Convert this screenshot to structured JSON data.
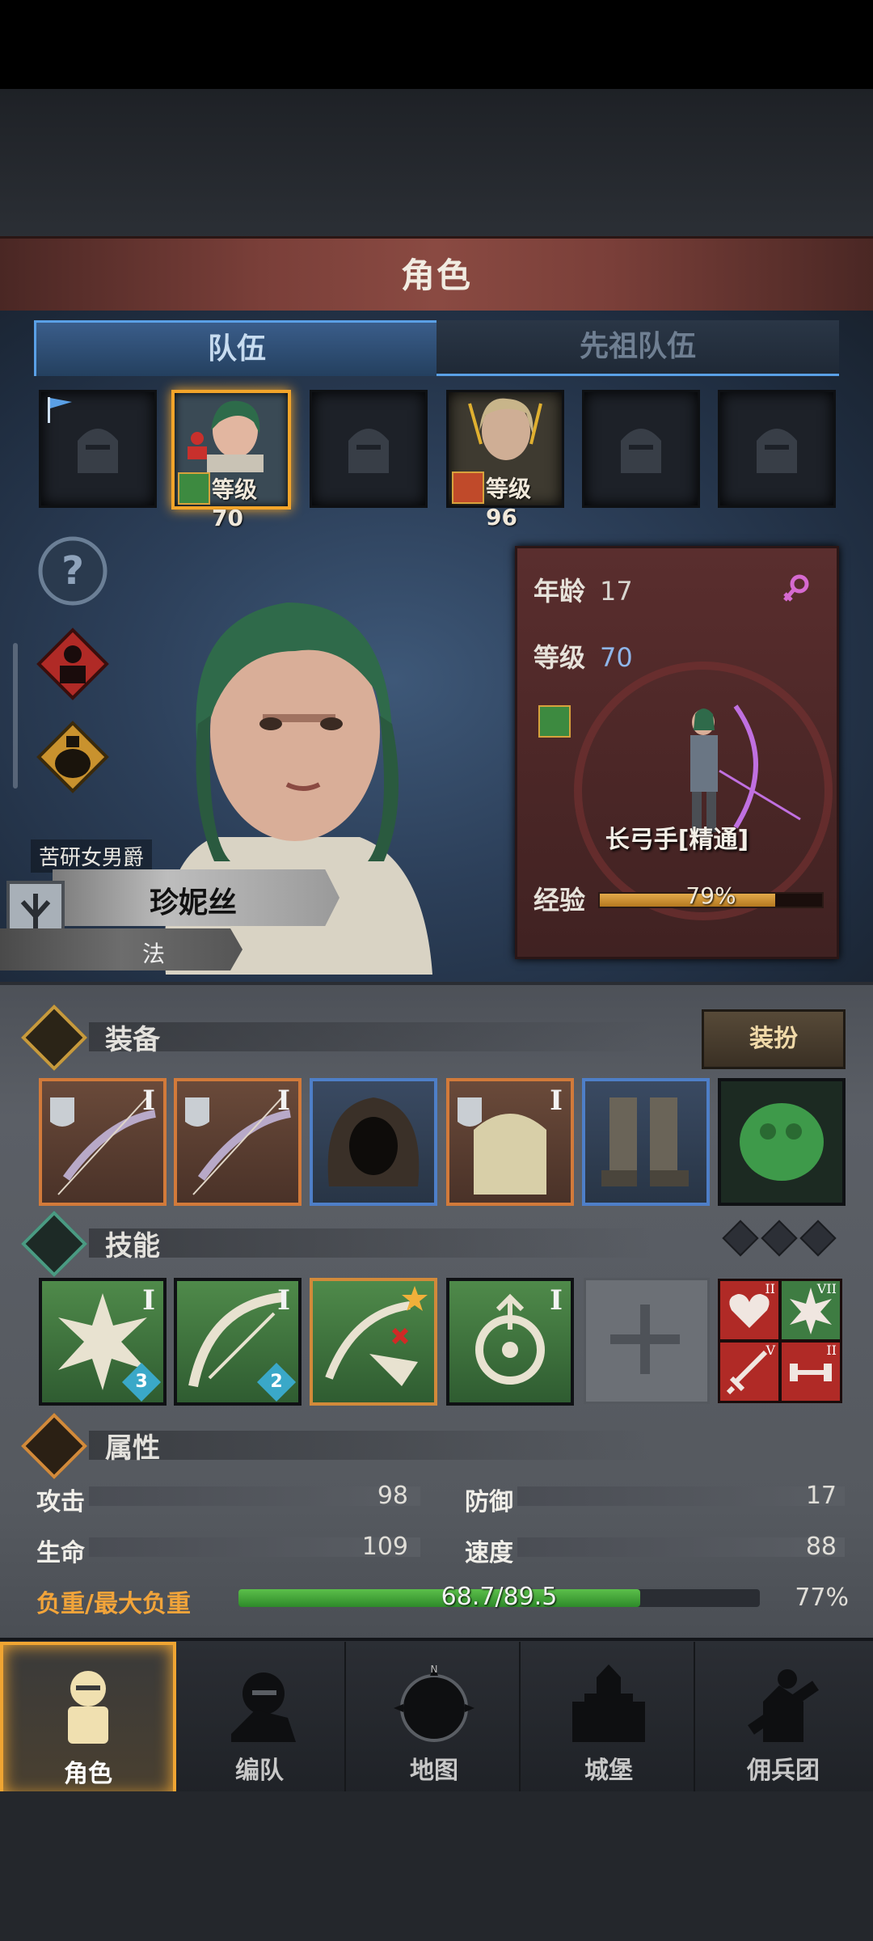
{
  "header": {
    "title": "角色"
  },
  "tabs": [
    {
      "label": "队伍",
      "active": true
    },
    {
      "label": "先祖队伍",
      "active": false
    }
  ],
  "party_slots": [
    {
      "kind": "empty",
      "flag": true
    },
    {
      "kind": "member",
      "level_label": "等级70",
      "selected": true
    },
    {
      "kind": "empty"
    },
    {
      "kind": "member",
      "level_label": "等级96"
    },
    {
      "kind": "empty"
    },
    {
      "kind": "empty"
    }
  ],
  "side_buttons": [
    "help-icon",
    "member-icon",
    "potion-icon"
  ],
  "character": {
    "title": "苦研女男爵",
    "name": "珍妮丝",
    "class_short": "法",
    "info": {
      "age_label": "年龄",
      "age": "17",
      "level_label": "等级",
      "level": "70",
      "class_name": "长弓手[精通]",
      "exp_label": "经验",
      "exp_pct_text": "79%",
      "exp_fraction": 0.79
    }
  },
  "sections": {
    "equipment": {
      "label": "装备",
      "dress_button": "装扮"
    },
    "skills": {
      "label": "技能"
    },
    "attributes": {
      "label": "属性"
    }
  },
  "equipment": [
    {
      "roman": "I",
      "rarity": "orange",
      "icon": "bow-icon"
    },
    {
      "roman": "I",
      "rarity": "orange",
      "icon": "bow-icon"
    },
    {
      "roman": "",
      "rarity": "blue",
      "icon": "hood-icon"
    },
    {
      "roman": "I",
      "rarity": "orange",
      "icon": "armor-icon"
    },
    {
      "roman": "",
      "rarity": "blue",
      "icon": "boots-icon"
    },
    {
      "roman": "",
      "rarity": "dark",
      "icon": "trinket-icon"
    }
  ],
  "skills": [
    {
      "roman": "I",
      "badge": "3",
      "icon": "burst-shot-icon"
    },
    {
      "roman": "I",
      "badge": "2",
      "icon": "bow-skill-icon"
    },
    {
      "roman": "",
      "badge": "",
      "icon": "strike-skill-icon",
      "gold": true
    },
    {
      "roman": "I",
      "badge": "",
      "icon": "target-icon"
    },
    {
      "roman": "",
      "badge": "",
      "icon": "empty-skill-slot-icon",
      "empty": true
    }
  ],
  "passives": [
    {
      "roman": "II",
      "icon": "heart-icon",
      "color": "red"
    },
    {
      "roman": "VII",
      "icon": "burst-icon",
      "color": "green"
    },
    {
      "roman": "V",
      "icon": "sword-icon",
      "color": "red"
    },
    {
      "roman": "II",
      "icon": "dumbbell-icon",
      "color": "red"
    }
  ],
  "stats": {
    "attack": {
      "label": "攻击",
      "value": "98"
    },
    "defense": {
      "label": "防御",
      "value": "17"
    },
    "hp": {
      "label": "生命",
      "value": "109"
    },
    "speed": {
      "label": "速度",
      "value": "88"
    },
    "load": {
      "label": "负重/最大负重",
      "value_text": "68.7/89.5",
      "pct_text": "77%",
      "fraction": 0.77
    }
  },
  "nav": [
    {
      "label": "角色",
      "active": true,
      "icon": "knight-icon"
    },
    {
      "label": "编队",
      "active": false,
      "icon": "formation-icon"
    },
    {
      "label": "地图",
      "active": false,
      "icon": "map-compass-icon"
    },
    {
      "label": "城堡",
      "active": false,
      "icon": "castle-icon"
    },
    {
      "label": "佣兵团",
      "active": false,
      "icon": "mercenary-icon"
    }
  ],
  "colors": {
    "accent_blue": "#5aa0e6",
    "accent_gold": "#f0a532",
    "load_green": "#4caf3f"
  }
}
